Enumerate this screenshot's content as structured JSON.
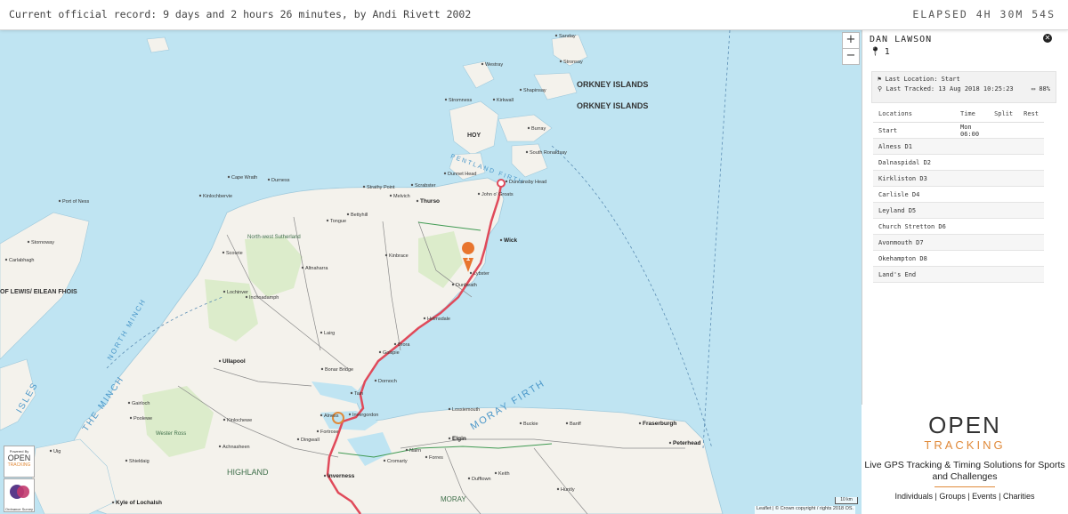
{
  "header": {
    "record": "Current official record: 9 days and 2 hours 26 minutes, by Andi Rivett 2002",
    "elapsed": "ELAPSED 4H 30M 54S"
  },
  "map": {
    "zoom_in": "+",
    "zoom_out": "−",
    "attribution": "Leaflet | © Crown copyright / rights 2018 OS.",
    "scale": "10 km",
    "sea_labels": [
      "MORAY FIRTH",
      "NORTH MINCH",
      "THE MINCH",
      "PENTLAND FIRTH"
    ],
    "island_labels": [
      "ORKNEY ISLANDS",
      "ORKNEY ISLANDS",
      "HOY"
    ],
    "region_labels": [
      "HIGHLAND",
      "MORAY",
      "North-west Sutherland",
      "Wester Ross",
      "OF LEWIS/ EILEAN FHOIS",
      "ISLES"
    ],
    "towns": [
      {
        "name": "Thurso"
      },
      {
        "name": "Wick"
      },
      {
        "name": "Inverness"
      },
      {
        "name": "Elgin"
      },
      {
        "name": "Fraserburgh"
      },
      {
        "name": "Peterhead"
      },
      {
        "name": "Ullapool"
      },
      {
        "name": "Stornoway"
      },
      {
        "name": "Dingwall"
      },
      {
        "name": "Dornoch"
      },
      {
        "name": "Golspie"
      },
      {
        "name": "Brora"
      },
      {
        "name": "Helmsdale"
      },
      {
        "name": "Lybster"
      },
      {
        "name": "Dunbeath"
      },
      {
        "name": "Alness"
      },
      {
        "name": "Tain"
      },
      {
        "name": "Lairg"
      },
      {
        "name": "Nairn"
      },
      {
        "name": "Forres"
      },
      {
        "name": "Kyle of Lochalsh"
      },
      {
        "name": "Bonar Bridge"
      },
      {
        "name": "Cromarty"
      },
      {
        "name": "Invergordon"
      },
      {
        "name": "Duncansby Head"
      },
      {
        "name": "John o' Groats"
      },
      {
        "name": "Kinbrace"
      },
      {
        "name": "Altnaharra"
      },
      {
        "name": "Scourie"
      },
      {
        "name": "Lochinver"
      },
      {
        "name": "Gairloch"
      },
      {
        "name": "Bettyhill"
      },
      {
        "name": "Tongue"
      },
      {
        "name": "Cape Wrath"
      },
      {
        "name": "Durness"
      },
      {
        "name": "Melvich"
      },
      {
        "name": "Stromness"
      },
      {
        "name": "Kirkwall"
      },
      {
        "name": "Dunnet Head"
      },
      {
        "name": "Sanday"
      },
      {
        "name": "Stronsay"
      },
      {
        "name": "Westray"
      },
      {
        "name": "Shapinsay"
      },
      {
        "name": "Burray"
      },
      {
        "name": "South Ronaldsay"
      },
      {
        "name": "Lossiemouth"
      },
      {
        "name": "Buckie"
      },
      {
        "name": "Banff"
      },
      {
        "name": "Huntly"
      },
      {
        "name": "Keith"
      },
      {
        "name": "Dufftown"
      },
      {
        "name": "Fortrose"
      },
      {
        "name": "Achnasheen"
      },
      {
        "name": "Shieldaig"
      },
      {
        "name": "Uig"
      },
      {
        "name": "Port of Ness"
      },
      {
        "name": "Carlabhagh"
      },
      {
        "name": "Poolewe"
      },
      {
        "name": "Kinlochewe"
      },
      {
        "name": "Inchnadamph"
      },
      {
        "name": "Kinlochbervie"
      },
      {
        "name": "Strathy Point"
      },
      {
        "name": "Scrabster"
      }
    ],
    "route_marker": "1"
  },
  "panel": {
    "runner_name": "DAN LAWSON",
    "runner_number": "1",
    "last_location": "Last Location: Start",
    "last_tracked": "Last Tracked: 13 Aug 2018 10:25:23",
    "battery": "88%",
    "table_headers": [
      "Locations",
      "Time",
      "Split",
      "Rest"
    ],
    "rows": [
      {
        "location": "Start",
        "time": "Mon 06:00",
        "split": "",
        "rest": ""
      },
      {
        "location": "Alness D1",
        "time": "",
        "split": "",
        "rest": ""
      },
      {
        "location": "Dalnaspidal D2",
        "time": "",
        "split": "",
        "rest": ""
      },
      {
        "location": "Kirkliston D3",
        "time": "",
        "split": "",
        "rest": ""
      },
      {
        "location": "Carlisle D4",
        "time": "",
        "split": "",
        "rest": ""
      },
      {
        "location": "Leyland D5",
        "time": "",
        "split": "",
        "rest": ""
      },
      {
        "location": "Church Stretton D6",
        "time": "",
        "split": "",
        "rest": ""
      },
      {
        "location": "Avonmouth D7",
        "time": "",
        "split": "",
        "rest": ""
      },
      {
        "location": "Okehampton D8",
        "time": "",
        "split": "",
        "rest": ""
      },
      {
        "location": "Land's End",
        "time": "",
        "split": "",
        "rest": ""
      }
    ]
  },
  "ad": {
    "logo_top": "OPEN",
    "logo_bottom": "TRACKING",
    "tagline": "Live GPS Tracking & Timing Solutions for Sports and Challenges",
    "links": "Individuals | Groups | Events | Charities"
  },
  "badges": {
    "powered_by": "Powered By",
    "open": "OPEN",
    "tracking": "TRACKING",
    "os": "Ordnance Survey"
  },
  "colors": {
    "sea": "#bfe4f2",
    "land": "#f4f2ec",
    "route": "#e04a5a",
    "accent": "#e08a3a"
  }
}
